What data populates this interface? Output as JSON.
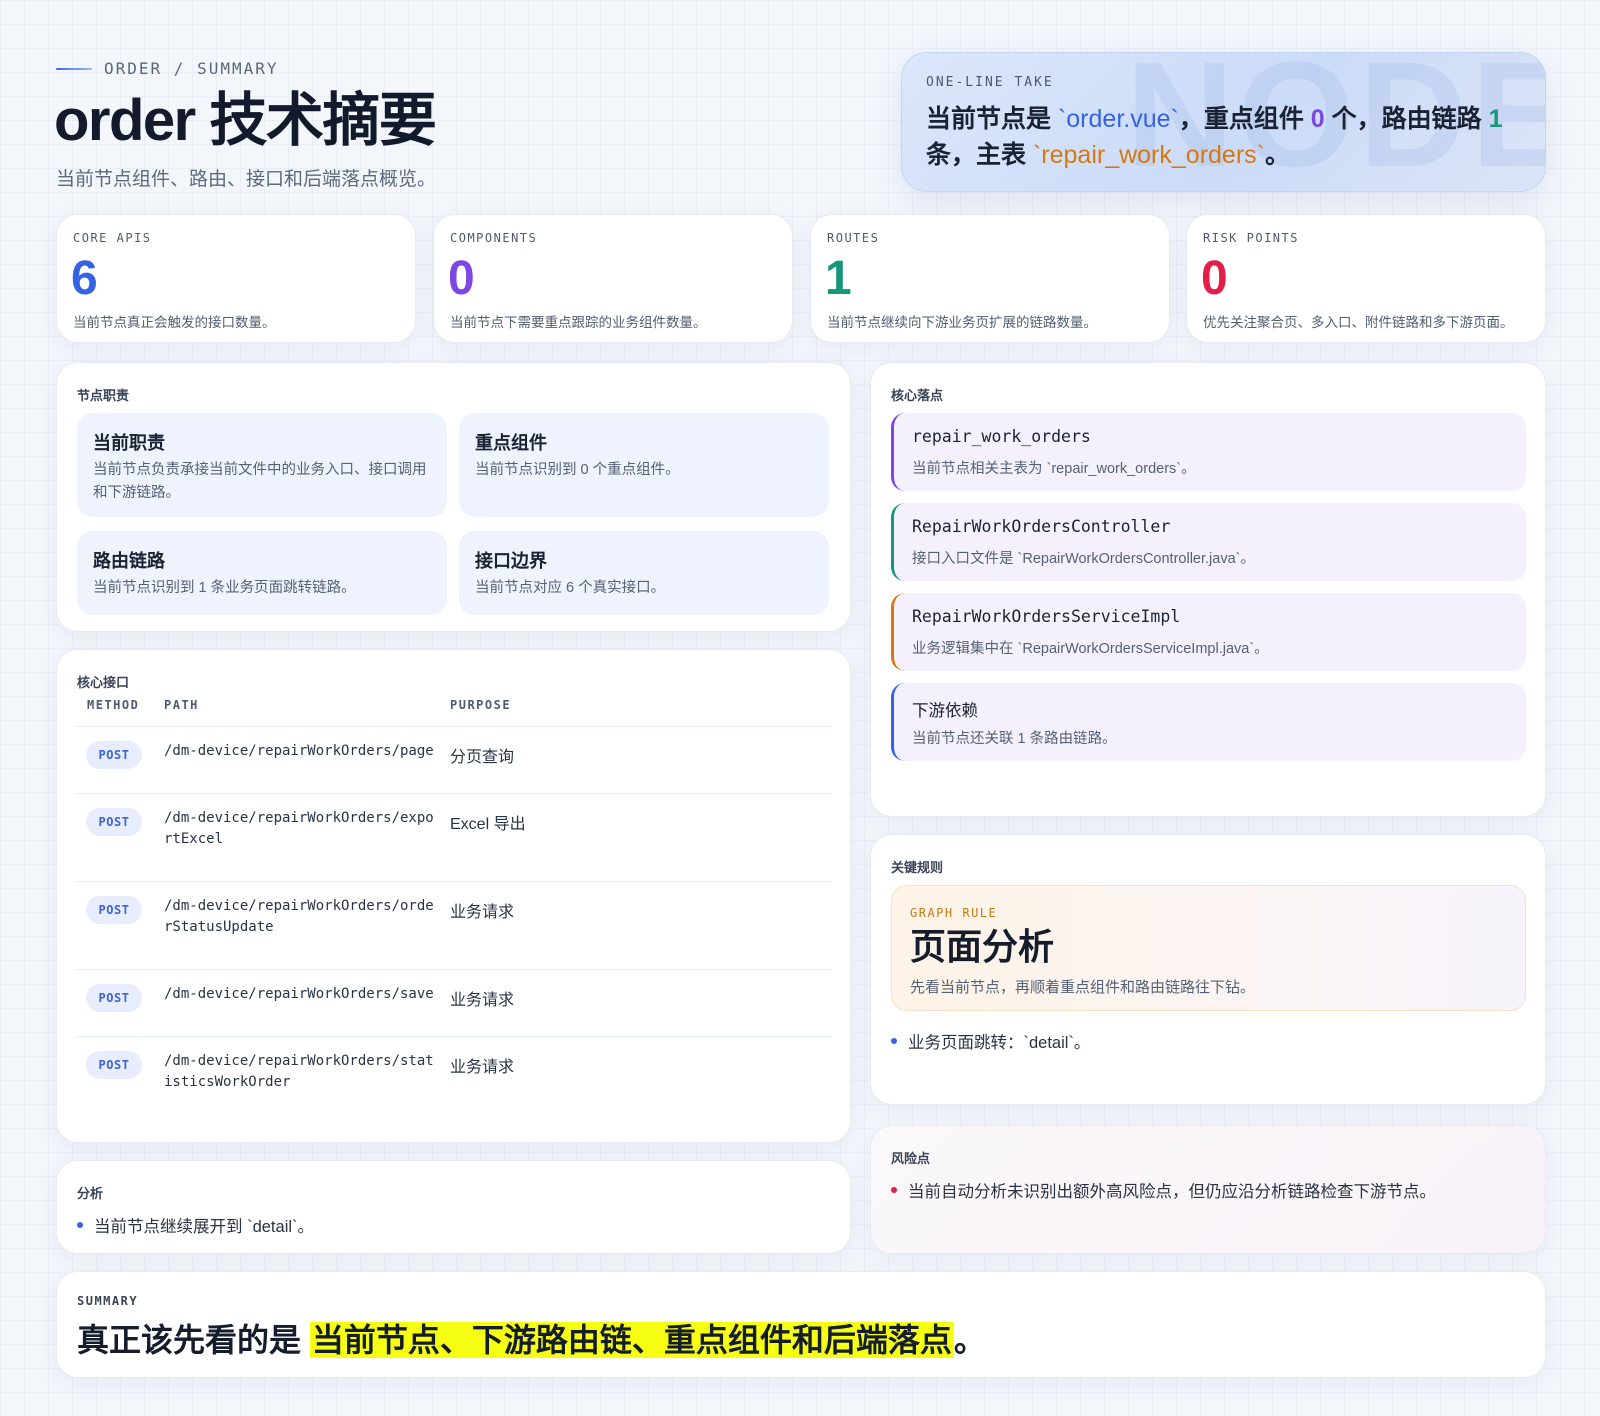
{
  "header": {
    "eyebrow": "ORDER / SUMMARY",
    "title": "order 技术摘要",
    "subtitle": "当前节点组件、路由、接口和后端落点概览。"
  },
  "take": {
    "label": "ONE-LINE TAKE",
    "ghost": "NODE",
    "p1": "当前节点是 ",
    "file": "`order.vue`",
    "p2": "，重点组件 ",
    "components": "0",
    "p3": " 个，路由链路 ",
    "routes": "1",
    "p4": " 条，主表 ",
    "table": "`repair_work_orders`",
    "p5": "。"
  },
  "stats": [
    {
      "key": "CORE APIS",
      "value": "6",
      "desc": "当前节点真正会触发的接口数量。",
      "color": "#3563e6"
    },
    {
      "key": "COMPONENTS",
      "value": "0",
      "desc": "当前节点下需要重点跟踪的业务组件数量。",
      "color": "#7d47e6"
    },
    {
      "key": "ROUTES",
      "value": "1",
      "desc": "当前节点继续向下游业务页扩展的链路数量。",
      "color": "#15977a"
    },
    {
      "key": "RISK POINTS",
      "value": "0",
      "desc": "优先关注聚合页、多入口、附件链路和多下游页面。",
      "color": "#e11d48"
    }
  ],
  "duties": {
    "title": "节点职责",
    "items": [
      {
        "heading": "当前职责",
        "text": "当前节点负责承接当前文件中的业务入口、接口调用和下游链路。"
      },
      {
        "heading": "重点组件",
        "text": "当前节点识别到 0 个重点组件。"
      },
      {
        "heading": "路由链路",
        "text": "当前节点识别到 1 条业务页面跳转链路。"
      },
      {
        "heading": "接口边界",
        "text": "当前节点对应 6 个真实接口。"
      }
    ]
  },
  "landing": {
    "title": "核心落点",
    "items": [
      {
        "heading": "repair_work_orders",
        "text": "当前节点相关主表为 `repair_work_orders`。",
        "color": "#7d47e6",
        "mono": true
      },
      {
        "heading": "RepairWorkOrdersController",
        "text": "接口入口文件是 `RepairWorkOrdersController.java`。",
        "color": "#15977a",
        "mono": true
      },
      {
        "heading": "RepairWorkOrdersServiceImpl",
        "text": "业务逻辑集中在 `RepairWorkOrdersServiceImpl.java`。",
        "color": "#d7770e",
        "mono": true
      },
      {
        "heading": "下游依赖",
        "text": "当前节点还关联 1 条路由链路。",
        "color": "#3563e6",
        "mono": false
      }
    ]
  },
  "apis": {
    "title": "核心接口",
    "columns": {
      "method": "METHOD",
      "path": "PATH",
      "purpose": "PURPOSE"
    },
    "rows": [
      {
        "method": "POST",
        "path": "/dm-device/repairWorkOrders/page",
        "purpose": "分页查询"
      },
      {
        "method": "POST",
        "path": "/dm-device/repairWorkOrders/exportExcel",
        "purpose": "Excel 导出"
      },
      {
        "method": "POST",
        "path": "/dm-device/repairWorkOrders/orderStatusUpdate",
        "purpose": "业务请求"
      },
      {
        "method": "POST",
        "path": "/dm-device/repairWorkOrders/save",
        "purpose": "业务请求"
      },
      {
        "method": "POST",
        "path": "/dm-device/repairWorkOrders/statisticsWorkOrder",
        "purpose": "业务请求"
      }
    ]
  },
  "rules": {
    "title": "关键规则",
    "rule_key": "GRAPH RULE",
    "rule_heading": "页面分析",
    "rule_text": "先看当前节点，再顺着重点组件和路由链路往下钻。",
    "bullet": "业务页面跳转：`detail`。"
  },
  "analysis": {
    "title": "分析",
    "bullet": "当前节点继续展开到 `detail`。"
  },
  "risk": {
    "title": "风险点",
    "bullet": "当前自动分析未识别出额外高风险点，但仍应沿分析链路检查下游节点。"
  },
  "summary": {
    "key": "SUMMARY",
    "lead": "真正该先看的是 ",
    "highlight": "当前节点、下游路由链、重点组件和后端落点",
    "tail": "。"
  }
}
